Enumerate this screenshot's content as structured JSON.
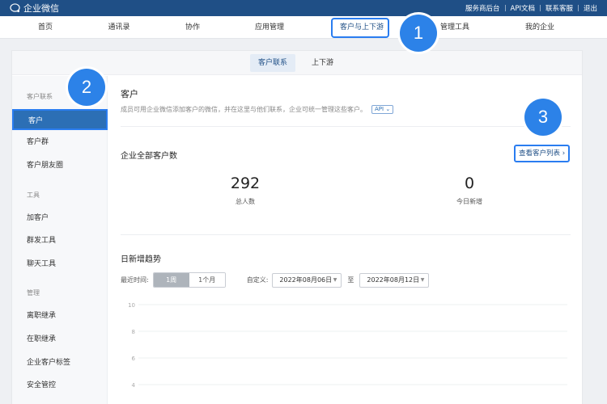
{
  "topbar": {
    "brand": "企业微信",
    "links": [
      "服务商后台",
      "API文档",
      "联系客服",
      "退出"
    ]
  },
  "nav": {
    "items": [
      "首页",
      "通讯录",
      "协作",
      "应用管理",
      "客户与上下游",
      "管理工具",
      "我的企业"
    ],
    "active_index": 4
  },
  "subtabs": [
    "客户联系",
    "上下游"
  ],
  "sidebar": {
    "group1": "客户联系",
    "items1": [
      "客户",
      "客户群",
      "客户朋友圈"
    ],
    "group2": "工具",
    "items2": [
      "加客户",
      "群发工具",
      "聊天工具"
    ],
    "group3": "管理",
    "items3": [
      "离职继承",
      "在职继承",
      "企业客户标签",
      "安全管控"
    ]
  },
  "content": {
    "title": "客户",
    "desc": "成员可用企业微信添加客户的微信，并在这里与他们联系，企业可统一管理这些客户。",
    "api_badge": "API",
    "section_title": "企业全部客户数",
    "view_list": "查看客户列表",
    "stats": [
      {
        "value": "292",
        "label": "总人数"
      },
      {
        "value": "0",
        "label": "今日新增"
      }
    ],
    "trend_title": "日新增趋势",
    "recent_label": "最近时间:",
    "range_options": [
      "1周",
      "1个月"
    ],
    "custom_label": "自定义:",
    "date_start": "2022年08月06日",
    "to_label": "至",
    "date_end": "2022年08月12日"
  },
  "chart_data": {
    "type": "line",
    "title": "",
    "ylim": [
      0,
      10
    ],
    "y_ticks": [
      "10",
      "8",
      "6",
      "4"
    ]
  },
  "badges": [
    "1",
    "2",
    "3"
  ],
  "colors": {
    "topbar": "#1f4f86",
    "accent": "#2c82e8",
    "highlight_border": "#2a7df0"
  }
}
